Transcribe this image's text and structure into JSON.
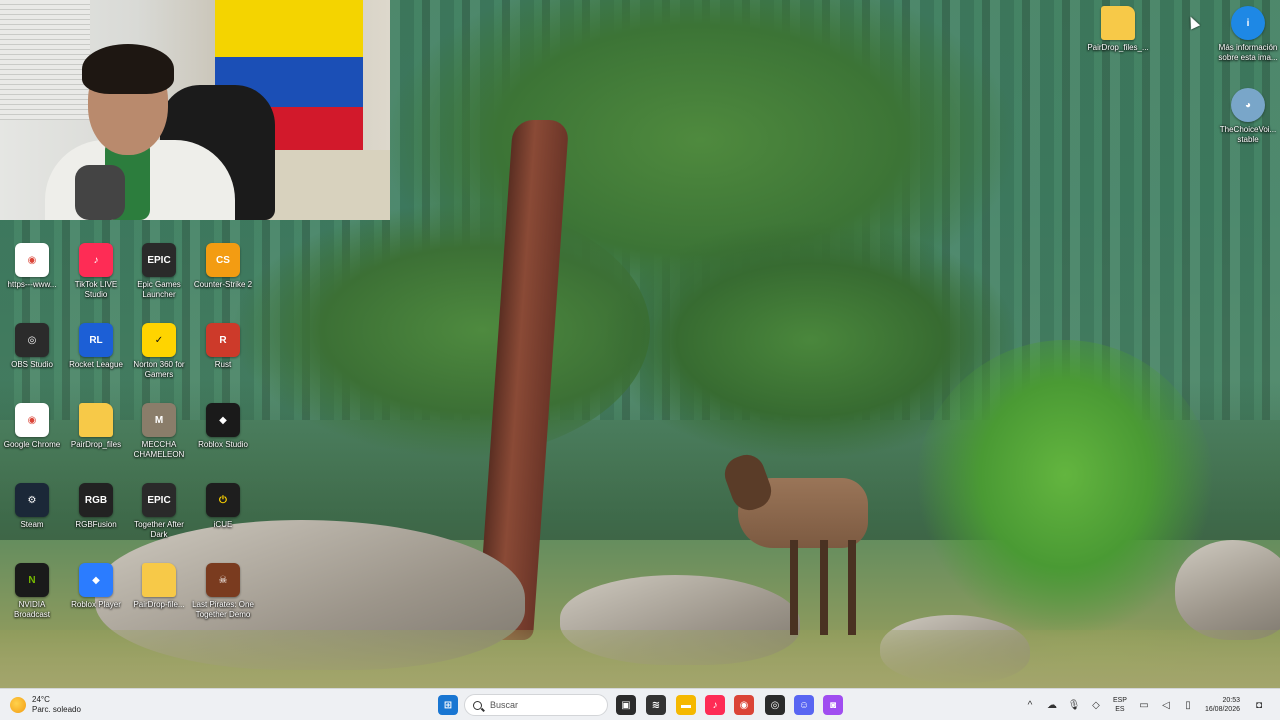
{
  "desktop": {
    "icons_left": [
      {
        "label": "https---www...",
        "icon": "chrome-shortcut-icon",
        "color": "#ffffff",
        "glyph": "◉",
        "fg": "#db4437"
      },
      {
        "label": "TikTok LIVE Studio",
        "icon": "tiktok-live-icon",
        "color": "#fe2c55",
        "glyph": "♪",
        "fg": "#ffffff"
      },
      {
        "label": "Epic Games Launcher",
        "icon": "epic-games-icon",
        "color": "#2a2a2a",
        "glyph": "EPIC",
        "fg": "#ffffff"
      },
      {
        "label": "Counter-Strike 2",
        "icon": "counter-strike-icon",
        "color": "#f39c12",
        "glyph": "CS",
        "fg": "#ffffff"
      },
      {
        "label": "OBS Studio",
        "icon": "obs-icon",
        "color": "#2b2b2b",
        "glyph": "◎",
        "fg": "#ffffff"
      },
      {
        "label": "Rocket League",
        "icon": "rocket-league-icon",
        "color": "#1c5fd6",
        "glyph": "RL",
        "fg": "#ffffff"
      },
      {
        "label": "Norton 360 for Gamers",
        "icon": "norton-icon",
        "color": "#ffd400",
        "glyph": "✓",
        "fg": "#111111"
      },
      {
        "label": "Rust",
        "icon": "rust-icon",
        "color": "#cd3a2a",
        "glyph": "R",
        "fg": "#ffffff"
      },
      {
        "label": "Google Chrome",
        "icon": "google-chrome-icon",
        "color": "#ffffff",
        "glyph": "◉",
        "fg": "#db4437"
      },
      {
        "label": "PairDrop_files",
        "icon": "folder-icon",
        "color": "#f7c948",
        "glyph": "",
        "fg": "#ffffff"
      },
      {
        "label": "MECCHA CHAMELEON",
        "icon": "meccha-chameleon-icon",
        "color": "#8a7d6a",
        "glyph": "M",
        "fg": "#ffffff"
      },
      {
        "label": "Roblox Studio",
        "icon": "roblox-studio-icon",
        "color": "#1a1a1a",
        "glyph": "◆",
        "fg": "#ffffff"
      },
      {
        "label": "Steam",
        "icon": "steam-icon",
        "color": "#1b2838",
        "glyph": "⚙",
        "fg": "#ffffff"
      },
      {
        "label": "RGBFusion",
        "icon": "rgb-fusion-icon",
        "color": "#222222",
        "glyph": "RGB",
        "fg": "#ffffff"
      },
      {
        "label": "Together After Dark",
        "icon": "epic-games-icon",
        "color": "#2a2a2a",
        "glyph": "EPIC",
        "fg": "#ffffff"
      },
      {
        "label": "iCUE",
        "icon": "icue-icon",
        "color": "#1e1e1e",
        "glyph": "⏻",
        "fg": "#ffd400"
      },
      {
        "label": "NVIDIA Broadcast",
        "icon": "nvidia-broadcast-icon",
        "color": "#1a1a1a",
        "glyph": "N",
        "fg": "#76b900"
      },
      {
        "label": "Roblox Player",
        "icon": "roblox-player-icon",
        "color": "#2b7cff",
        "glyph": "◆",
        "fg": "#ffffff"
      },
      {
        "label": "PairDrop-file...",
        "icon": "folder-icon",
        "color": "#f7c948",
        "glyph": "",
        "fg": "#ffffff"
      },
      {
        "label": "Last Pirates: One Together Demo",
        "icon": "last-pirates-icon",
        "color": "#7a3b1f",
        "glyph": "☠",
        "fg": "#ffffff"
      }
    ],
    "icons_right": [
      {
        "label": "PairDrop_files_...",
        "icon": "folder-icon",
        "color": "#f7c948",
        "glyph": "",
        "fg": "#ffffff"
      },
      {
        "label": "Más información sobre esta ima...",
        "icon": "image-info-icon",
        "color": "#1e88e5",
        "glyph": "i",
        "fg": "#ffffff"
      },
      {
        "label": "TheChoiceVoi... stable",
        "icon": "the-choice-voice-icon",
        "color": "#79a6c9",
        "glyph": "◕",
        "fg": "#ffffff"
      }
    ]
  },
  "taskbar": {
    "weather_temp": "24°C",
    "weather_desc": "Parc. soleado",
    "search_placeholder": "Buscar",
    "apps": [
      {
        "name": "start",
        "icon": "windows-start-icon",
        "color": "#1976d2",
        "glyph": "⊞"
      },
      {
        "name": "task-view",
        "icon": "task-view-icon",
        "color": "#2b2b2b",
        "glyph": "▣"
      },
      {
        "name": "widget",
        "icon": "widgets-icon",
        "color": "#333333",
        "glyph": "≋"
      },
      {
        "name": "explorer",
        "icon": "file-explorer-icon",
        "color": "#f5b800",
        "glyph": "▬"
      },
      {
        "name": "tiktok",
        "icon": "tiktok-live-icon",
        "color": "#fe2c55",
        "glyph": "♪"
      },
      {
        "name": "chrome",
        "icon": "google-chrome-icon",
        "color": "#db4437",
        "glyph": "◉"
      },
      {
        "name": "obs",
        "icon": "obs-icon",
        "color": "#2b2b2b",
        "glyph": "◎"
      },
      {
        "name": "discord",
        "icon": "discord-icon",
        "color": "#5865f2",
        "glyph": "☺"
      },
      {
        "name": "app",
        "icon": "camera-app-icon",
        "color": "#a04df0",
        "glyph": "◙"
      }
    ],
    "tray": {
      "language_top": "ESP",
      "language_bottom": "ES",
      "time": "20:53",
      "date": "16/08/2026"
    }
  }
}
